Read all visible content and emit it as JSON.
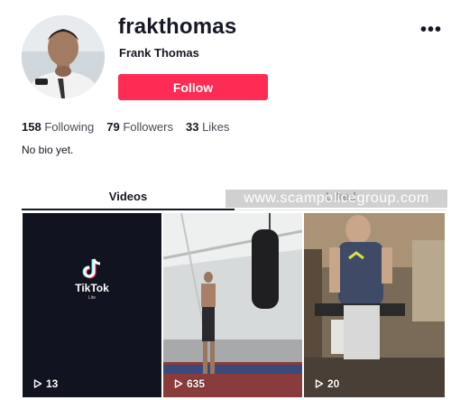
{
  "profile": {
    "username": "frakthomas",
    "display_name": "Frank Thomas",
    "follow_label": "Follow",
    "more_icon": "•••",
    "bio": "No bio yet."
  },
  "stats": [
    {
      "count": "158",
      "label": "Following"
    },
    {
      "count": "79",
      "label": "Followers"
    },
    {
      "count": "33",
      "label": "Likes"
    }
  ],
  "tabs": [
    {
      "label": "Videos",
      "active": true
    },
    {
      "label": "Liked",
      "active": false
    }
  ],
  "watermark": "www.scampolicegroup.com",
  "videos": [
    {
      "plays": "13",
      "logo_name": "TikTok",
      "logo_sub": "Lite"
    },
    {
      "plays": "635"
    },
    {
      "plays": "20"
    }
  ],
  "colors": {
    "accent": "#fe2c55",
    "text": "#161823",
    "muted": "#8a8b91"
  }
}
